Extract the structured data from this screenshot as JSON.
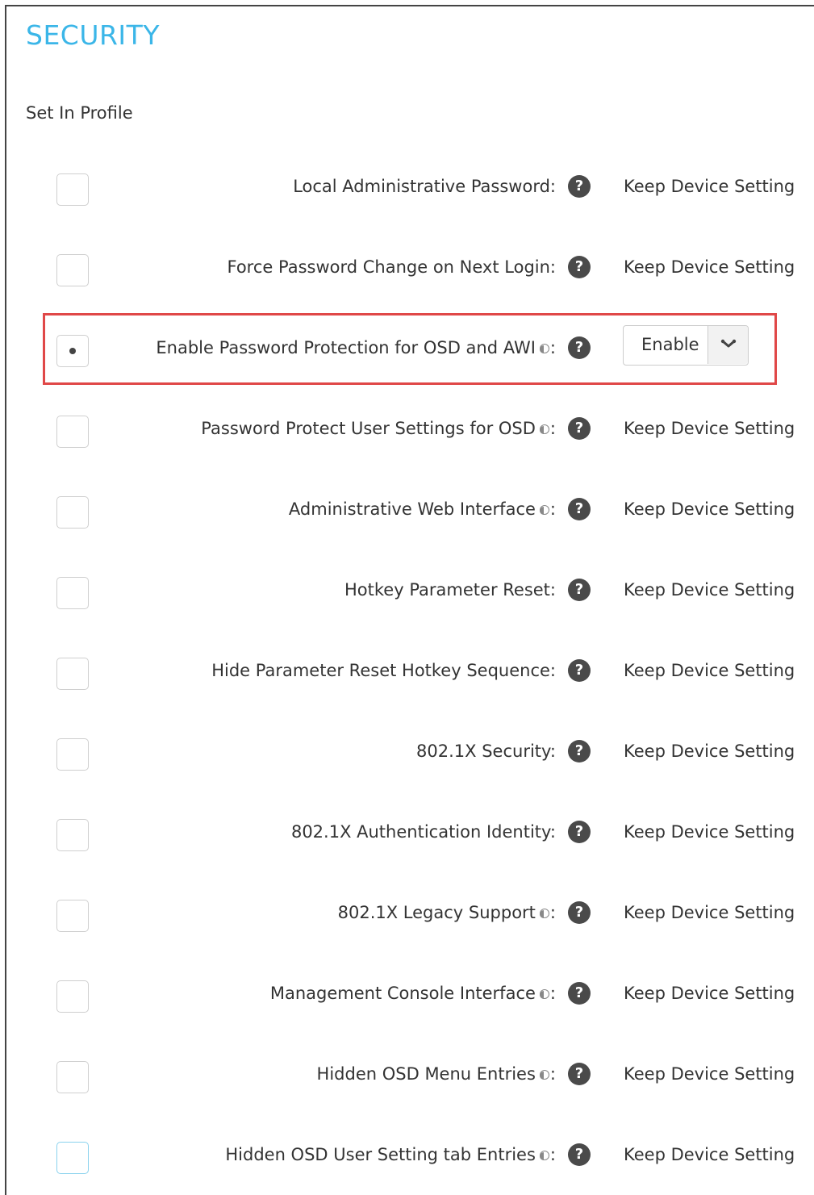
{
  "section": {
    "title": "SECURITY",
    "subtitle": "Set In Profile"
  },
  "rows": [
    {
      "label": "Local Administrative Password:",
      "value": "Keep Device Setting"
    },
    {
      "label": "Force Password Change on Next Login:",
      "value": "Keep Device Setting"
    },
    {
      "label": "Enable Password Protection for OSD and AWI",
      "suffix": ":",
      "value": "Enable"
    },
    {
      "label": "Password Protect User Settings for OSD",
      "suffix": ":",
      "value": "Keep Device Setting"
    },
    {
      "label": "Administrative Web Interface",
      "suffix": ":",
      "value": "Keep Device Setting"
    },
    {
      "label": "Hotkey Parameter Reset:",
      "value": "Keep Device Setting"
    },
    {
      "label": "Hide Parameter Reset Hotkey Sequence:",
      "value": "Keep Device Setting"
    },
    {
      "label": "802.1X Security:",
      "value": "Keep Device Setting"
    },
    {
      "label": "802.1X Authentication Identity:",
      "value": "Keep Device Setting"
    },
    {
      "label": "802.1X Legacy Support",
      "suffix": ":",
      "value": "Keep Device Setting"
    },
    {
      "label": "Management Console Interface",
      "suffix": ":",
      "value": "Keep Device Setting"
    },
    {
      "label": "Hidden OSD Menu Entries",
      "suffix": ":",
      "value": "Keep Device Setting"
    },
    {
      "label": "Hidden OSD User Setting tab Entries",
      "suffix": ":",
      "value": "Keep Device Setting"
    }
  ],
  "help_glyph": "?",
  "icons": {
    "help": "question-circle-icon",
    "inherit": "half-circle-inherit-icon",
    "dropdown": "chevron-down-icon"
  },
  "colors": {
    "title": "#3bb6e8",
    "highlight": "#e04848"
  }
}
